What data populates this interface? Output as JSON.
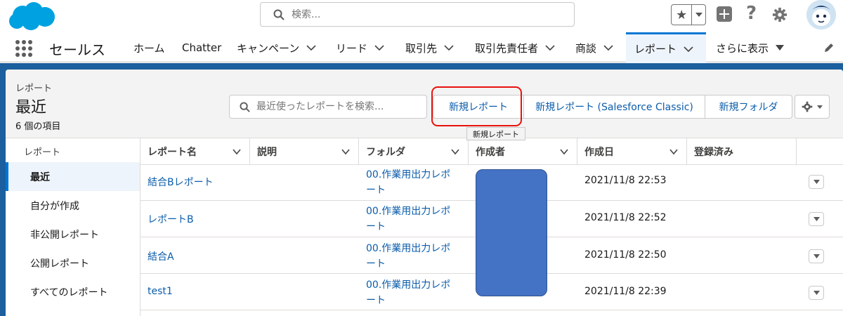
{
  "header": {
    "search_placeholder": "検索..."
  },
  "nav": {
    "app_name": "セールス",
    "items": [
      {
        "label": "ホーム"
      },
      {
        "label": "Chatter"
      },
      {
        "label": "キャンペーン"
      },
      {
        "label": "リード"
      },
      {
        "label": "取引先"
      },
      {
        "label": "取引先責任者"
      },
      {
        "label": "商談"
      },
      {
        "label": "レポート"
      },
      {
        "label": "さらに表示"
      }
    ]
  },
  "list_header": {
    "object_label": "レポート",
    "title": "最近",
    "count": "6 個の項目",
    "search_placeholder": "最近使ったレポートを検索...",
    "buttons": {
      "new_report": "新規レポート",
      "new_report_classic": "新規レポート (Salesforce Classic)",
      "new_folder": "新規フォルダ"
    },
    "tooltip": "新規レポート"
  },
  "sidebar": {
    "heading": "レポート",
    "items": [
      {
        "label": "最近"
      },
      {
        "label": "自分が作成"
      },
      {
        "label": "非公開レポート"
      },
      {
        "label": "公開レポート"
      },
      {
        "label": "すべてのレポート"
      }
    ]
  },
  "table": {
    "columns": [
      {
        "label": "レポート名"
      },
      {
        "label": "説明"
      },
      {
        "label": "フォルダ"
      },
      {
        "label": "作成者"
      },
      {
        "label": "作成日"
      },
      {
        "label": "登録済み"
      }
    ],
    "rows": [
      {
        "name": "結合Bレポート",
        "description": "",
        "folder_line1": "00.作業用出力レポ",
        "folder_line2": "ート",
        "created_date": "2021/11/8 22:53"
      },
      {
        "name": "レポートB",
        "description": "",
        "folder_line1": "00.作業用出力レポ",
        "folder_line2": "ート",
        "created_date": "2021/11/8 22:52"
      },
      {
        "name": "結合A",
        "description": "",
        "folder_line1": "00.作業用出力レポ",
        "folder_line2": "ート",
        "created_date": "2021/11/8 22:50"
      },
      {
        "name": "test1",
        "description": "",
        "folder_line1": "00.作業用出力レポ",
        "folder_line2": "ート",
        "created_date": "2021/11/8 22:39"
      }
    ]
  },
  "colors": {
    "brand_blue": "#0176d3",
    "link_blue": "#0b5cab",
    "page_background": "#1b5f9e",
    "highlight_red": "#e8120c",
    "redaction_fill": "#4472c4"
  }
}
